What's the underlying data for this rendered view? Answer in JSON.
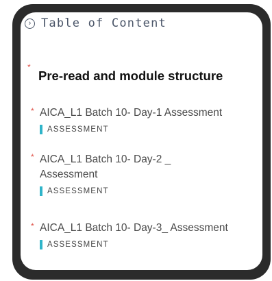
{
  "toc": {
    "title": "Table of Content",
    "toggle_icon": "chevron-right-circle-icon"
  },
  "section": {
    "required_mark": "*",
    "title": "Pre-read and module structure"
  },
  "items": [
    {
      "required_mark": "*",
      "title": "AICA_L1 Batch 10- Day-1 Assessment",
      "type": "ASSESSMENT"
    },
    {
      "required_mark": "*",
      "title": "AICA_L1 Batch 10- Day-2 _ Assessment",
      "type": "ASSESSMENT"
    },
    {
      "required_mark": "*",
      "title": "AICA_L1 Batch 10- Day-3_ Assessment",
      "type": "ASSESSMENT"
    }
  ],
  "colors": {
    "frame": "#2b2b2b",
    "type_accent": "#2fb4c9",
    "required": "#e0544a"
  }
}
